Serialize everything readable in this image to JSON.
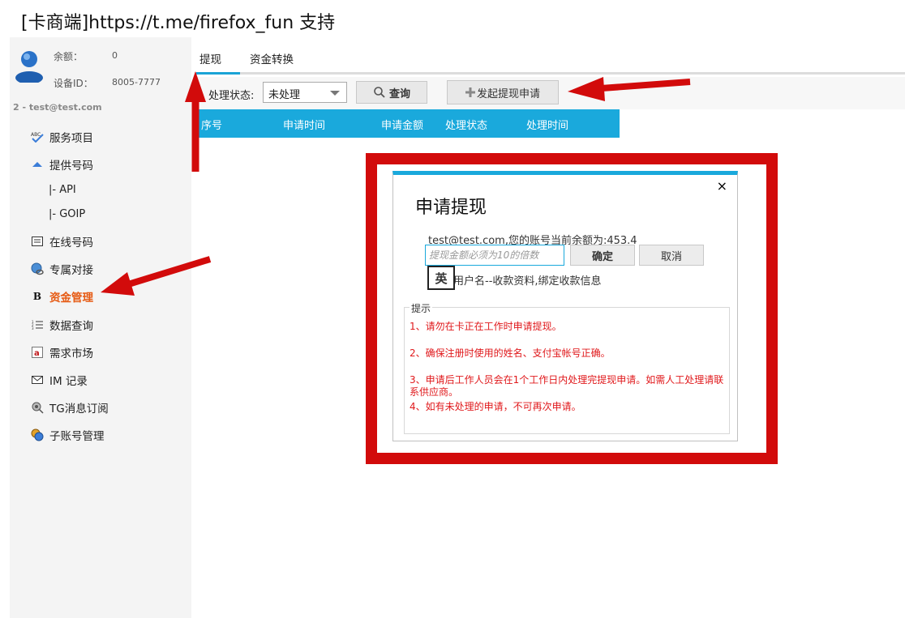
{
  "page": {
    "title": "[卡商端]https://t.me/firefox_fun 支持"
  },
  "user": {
    "balance_label": "余额：",
    "balance_value": "0",
    "device_label": "设备ID：",
    "device_value": "8005-7777",
    "account": "2 - test@test.com"
  },
  "sidebar": {
    "items": [
      {
        "label": "服务项目",
        "icon": "abc-check-icon"
      },
      {
        "label": "提供号码",
        "icon": "arrow-up-icon"
      },
      {
        "label": "|-  API",
        "icon": ""
      },
      {
        "label": "|-  GOIP",
        "icon": ""
      },
      {
        "label": "在线号码",
        "icon": "list-icon"
      },
      {
        "label": "专属对接",
        "icon": "globe-link-icon"
      },
      {
        "label": "资金管理",
        "icon": "bold-b-icon"
      },
      {
        "label": "数据查询",
        "icon": "numbered-list-icon"
      },
      {
        "label": "需求市场",
        "icon": "mail-a-icon"
      },
      {
        "label": "IM 记录",
        "icon": "envelope-icon"
      },
      {
        "label": "TG消息订阅",
        "icon": "satellite-icon"
      },
      {
        "label": "子账号管理",
        "icon": "users-icon"
      }
    ],
    "active_index": 6,
    "active_color": "#e65a13"
  },
  "tabs": [
    {
      "label": "提现"
    },
    {
      "label": "资金转换"
    }
  ],
  "toolbar": {
    "status_label": "处理状态:",
    "status_value": "未处理",
    "query_label": "查询",
    "apply_label": "发起提现申请"
  },
  "table": {
    "headers": [
      "序号",
      "申请时间",
      "申请金额",
      "处理状态",
      "处理时间"
    ],
    "header_color": "#1aa9dc"
  },
  "modal": {
    "title": "申请提现",
    "close": "×",
    "balance_text": "test@test.com,您的账号当前余额为:453.4",
    "amount_placeholder": "提现金额必须为10的倍数",
    "ok_label": "确定",
    "cancel_label": "取消",
    "ime_label": "英",
    "bind_text": "用户名--收款资料,绑定收款信息",
    "tips_title": "提示",
    "tips": [
      "1、请勿在卡正在工作时申请提现。",
      "2、确保注册时使用的姓名、支付宝帐号正确。",
      "3、申请后工作人员会在1个工作日内处理完提现申请。如需人工处理请联系供应商。",
      "4、如有未处理的申请，不可再次申请。"
    ],
    "accent_color": "#1aa9dc"
  },
  "annotations": {
    "color": "#d20b0b"
  }
}
